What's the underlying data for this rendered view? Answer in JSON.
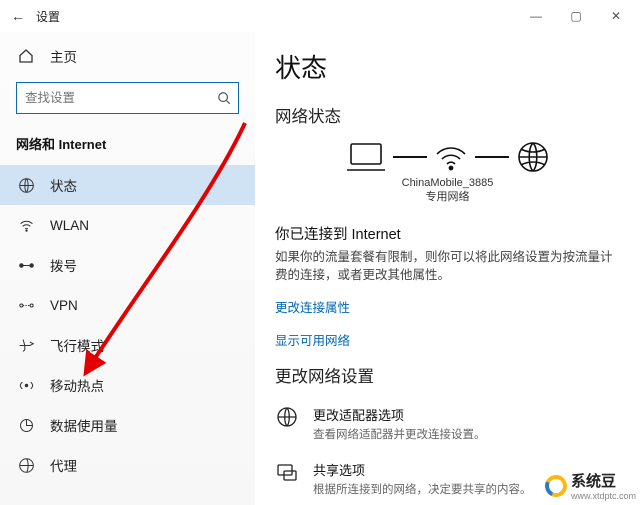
{
  "titlebar": {
    "title": "设置"
  },
  "sidebar": {
    "home_label": "主页",
    "search_placeholder": "查找设置",
    "section_label": "网络和 Internet",
    "items": [
      {
        "label": "状态"
      },
      {
        "label": "WLAN"
      },
      {
        "label": "拨号"
      },
      {
        "label": "VPN"
      },
      {
        "label": "飞行模式"
      },
      {
        "label": "移动热点"
      },
      {
        "label": "数据使用量"
      },
      {
        "label": "代理"
      }
    ]
  },
  "content": {
    "heading": "状态",
    "network_status_label": "网络状态",
    "ssid": "ChinaMobile_3885",
    "net_type": "专用网络",
    "connected_title": "你已连接到 Internet",
    "connected_desc": "如果你的流量套餐有限制，则你可以将此网络设置为按流量计费的连接，或者更改其他属性。",
    "link_change_props": "更改连接属性",
    "link_show_networks": "显示可用网络",
    "change_settings_label": "更改网络设置",
    "options": [
      {
        "title": "更改适配器选项",
        "desc": "查看网络适配器并更改连接设置。"
      },
      {
        "title": "共享选项",
        "desc": "根据所连接到的网络，决定要共享的内容。"
      }
    ]
  },
  "watermark": {
    "text": "系统豆",
    "url": "www.xtdptc.com"
  }
}
